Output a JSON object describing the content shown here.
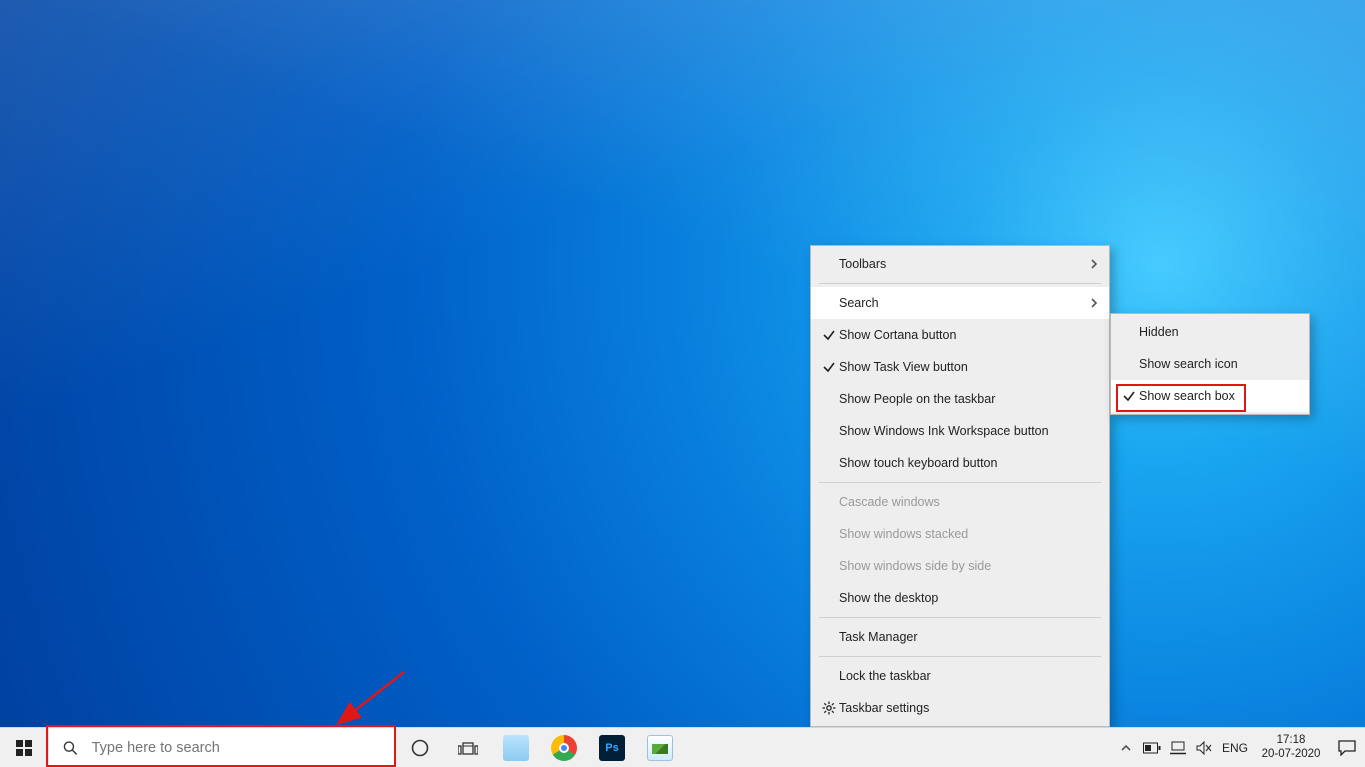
{
  "taskbar": {
    "search_placeholder": "Type here to search",
    "apps": [
      {
        "name": "notepad",
        "bg": "linear-gradient(#b9e3ff,#8ccbf0)"
      },
      {
        "name": "chrome",
        "bg": "conic-gradient(#ea4335 0 120deg,#34a853 120deg 240deg,#fbbc05 240deg 360deg)"
      },
      {
        "name": "photoshop",
        "bg": "#001e36",
        "text": "Ps",
        "fg": "#31a8ff"
      },
      {
        "name": "photos",
        "bg": "linear-gradient(#fff,#cfeaff)"
      }
    ],
    "tray": {
      "language": "ENG",
      "time": "17:18",
      "date": "20-07-2020"
    }
  },
  "context_menu": {
    "items": [
      {
        "label": "Toolbars",
        "submenu": true
      },
      {
        "sep": true
      },
      {
        "label": "Search",
        "submenu": true,
        "hovered": true
      },
      {
        "label": "Show Cortana button",
        "checked": true
      },
      {
        "label": "Show Task View button",
        "checked": true
      },
      {
        "label": "Show People on the taskbar"
      },
      {
        "label": "Show Windows Ink Workspace button"
      },
      {
        "label": "Show touch keyboard button"
      },
      {
        "sep": true
      },
      {
        "label": "Cascade windows",
        "disabled": true
      },
      {
        "label": "Show windows stacked",
        "disabled": true
      },
      {
        "label": "Show windows side by side",
        "disabled": true
      },
      {
        "label": "Show the desktop"
      },
      {
        "sep": true
      },
      {
        "label": "Task Manager"
      },
      {
        "sep": true
      },
      {
        "label": "Lock the taskbar"
      },
      {
        "label": "Taskbar settings",
        "gear": true
      }
    ]
  },
  "search_submenu": {
    "items": [
      {
        "label": "Hidden"
      },
      {
        "label": "Show search icon"
      },
      {
        "label": "Show search box",
        "checked": true,
        "selected": true
      }
    ]
  }
}
